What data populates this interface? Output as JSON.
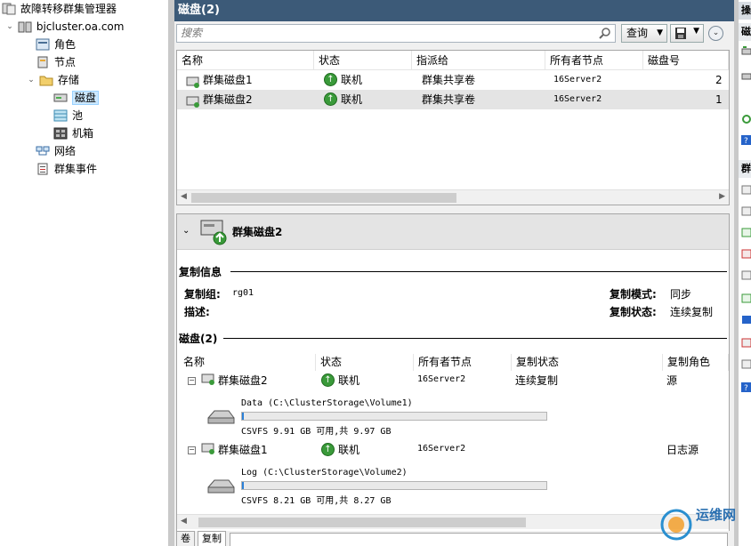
{
  "tree": {
    "root": "故障转移群集管理器",
    "cluster": "bjcluster.oa.com",
    "roles": "角色",
    "nodes": "节点",
    "storage": "存储",
    "disks": "磁盘",
    "pools": "池",
    "enclosures": "机箱",
    "networks": "网络",
    "events": "群集事件"
  },
  "header": {
    "title": "磁盘(2)"
  },
  "toolbar": {
    "search_placeholder": "搜索",
    "query_label": "查询"
  },
  "grid": {
    "columns": [
      "名称",
      "状态",
      "指派给",
      "所有者节点",
      "磁盘号"
    ],
    "rows": [
      {
        "name": "群集磁盘1",
        "status": "联机",
        "assigned": "群集共享卷",
        "owner": "16Server2",
        "number": "2"
      },
      {
        "name": "群集磁盘2",
        "status": "联机",
        "assigned": "群集共享卷",
        "owner": "16Server2",
        "number": "1"
      }
    ]
  },
  "detail": {
    "title": "群集磁盘2",
    "replication_section": "复制信息",
    "group_label": "复制组:",
    "group_value": "rg01",
    "desc_label": "描述:",
    "mode_label": "复制模式:",
    "mode_value": "同步",
    "state_label": "复制状态:",
    "state_value": "连续复制",
    "disks_section": "磁盘(2)",
    "columns": [
      "名称",
      "状态",
      "所有者节点",
      "复制状态",
      "复制角色"
    ],
    "rows": [
      {
        "name": "群集磁盘2",
        "status": "联机",
        "owner": "16Server2",
        "repl_state": "连续复制",
        "repl_role": "源",
        "volume": "Data (C:\\ClusterStorage\\Volume1)",
        "usage": "CSVFS 9.91 GB 可用,共 9.97 GB",
        "used_fraction": 0.006
      },
      {
        "name": "群集磁盘1",
        "status": "联机",
        "owner": "16Server2",
        "repl_state": "",
        "repl_role": "日志源",
        "volume": "Log (C:\\ClusterStorage\\Volume2)",
        "usage": "CSVFS 8.21 GB 可用,共 8.27 GB",
        "used_fraction": 0.007
      }
    ]
  },
  "tabs": [
    "卷",
    "复制"
  ],
  "actions": {
    "header1": "操",
    "header2": "磁",
    "header3": "群"
  },
  "watermark": "运维网"
}
